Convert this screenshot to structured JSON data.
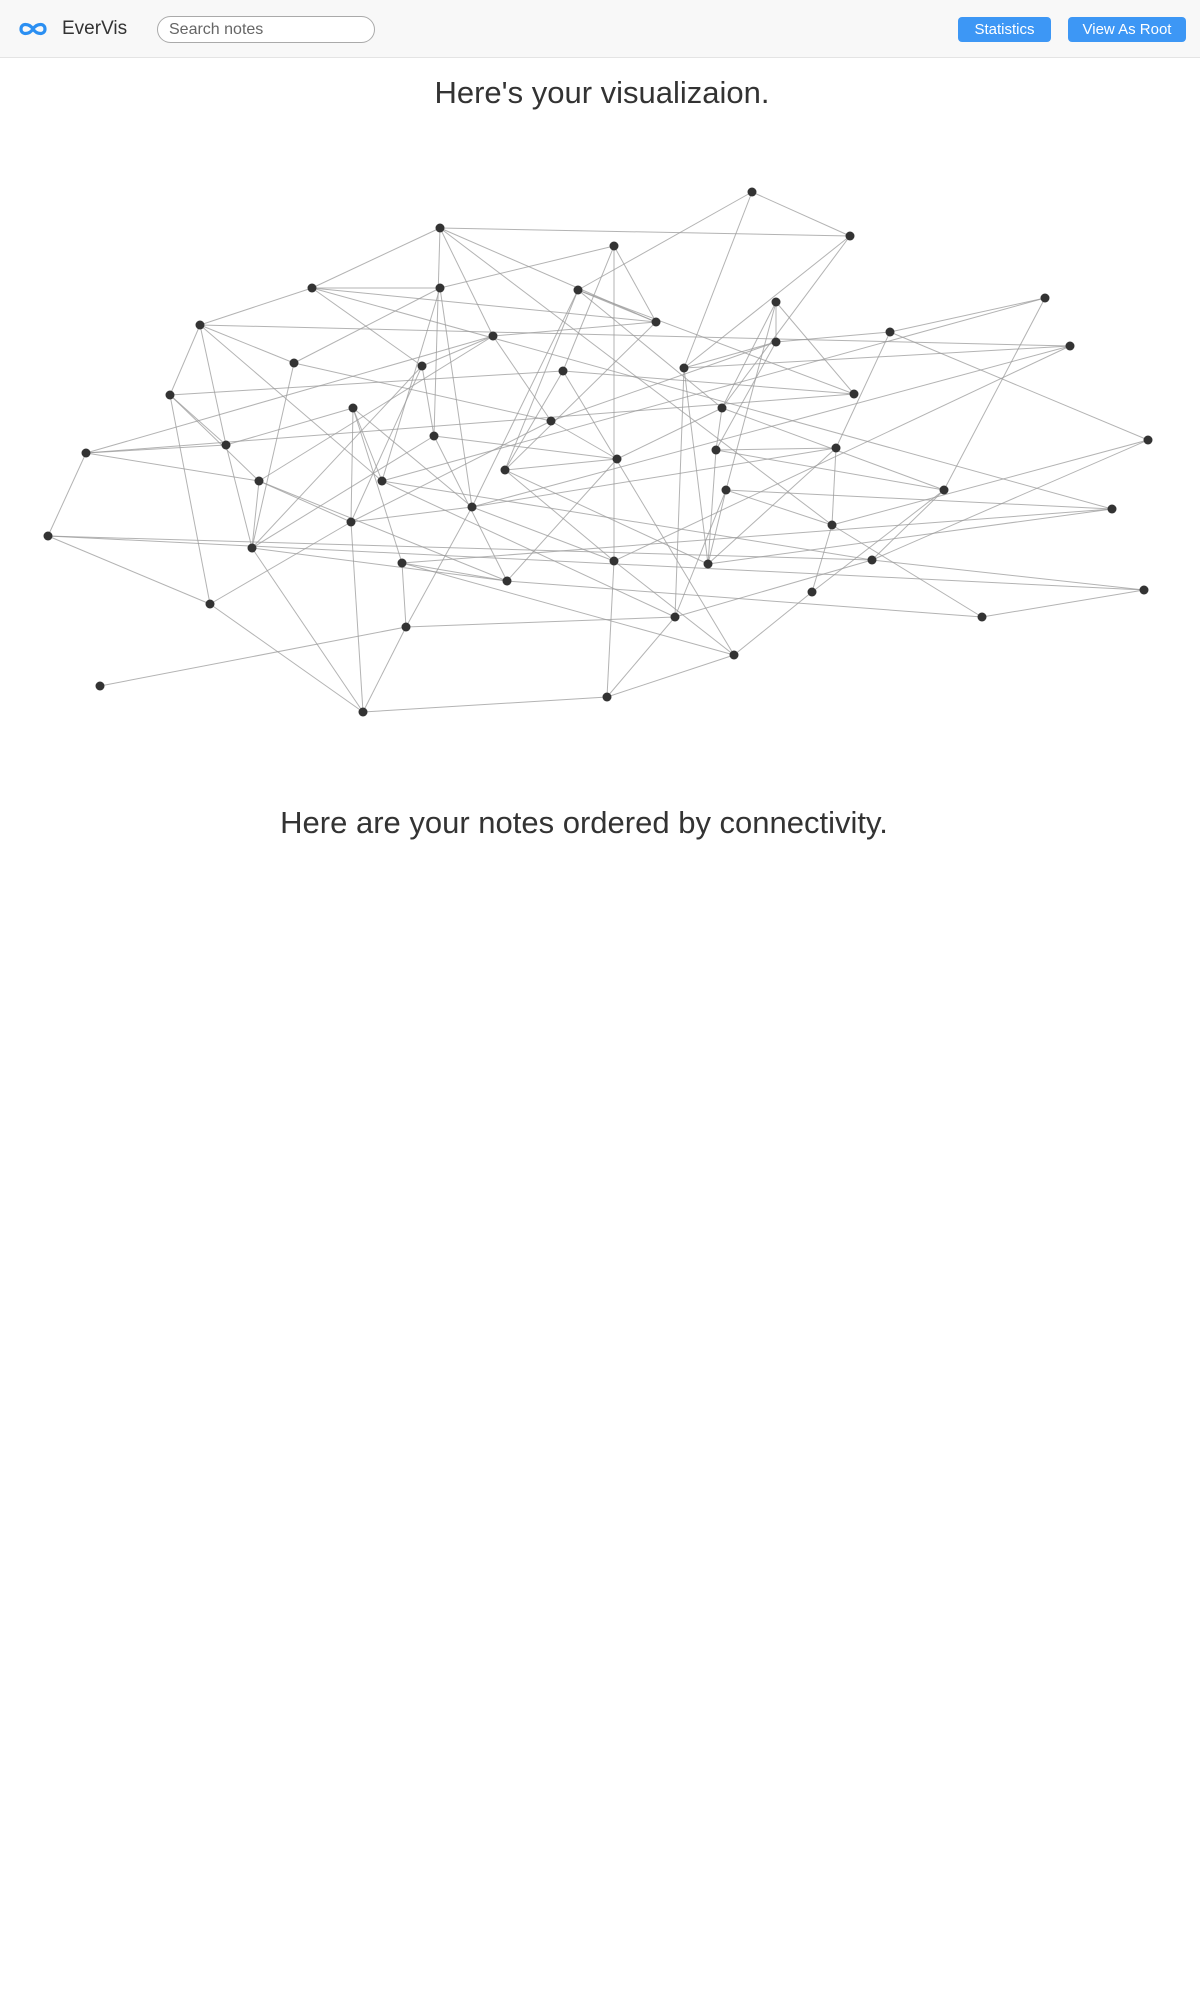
{
  "navbar": {
    "brand_icon": "infinity-logo-icon",
    "brand_name": "EverVis",
    "search_placeholder": "Search notes",
    "search_value": "",
    "statistics_label": "Statistics",
    "view_as_root_label": "View As Root",
    "accent_color": "#3d97f5"
  },
  "main": {
    "visualization_heading": "Here's your visualizaion.",
    "notes_heading": "Here are your notes ordered by connectivity.",
    "notes": []
  }
}
